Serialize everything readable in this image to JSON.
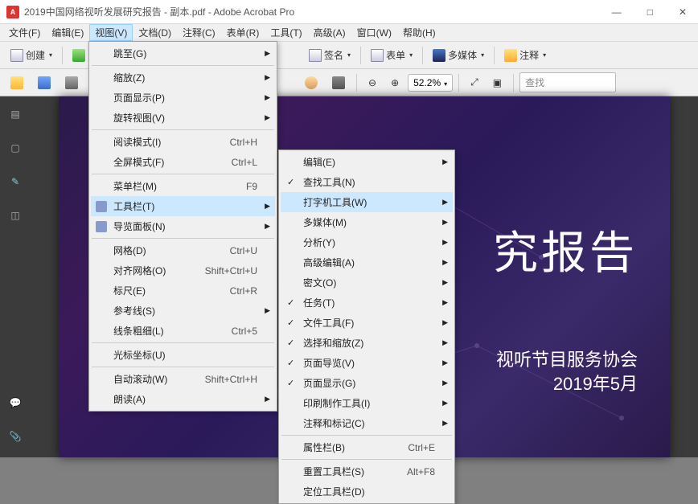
{
  "window": {
    "title": "2019中国网络视听发展研究报告 - 副本.pdf - Adobe Acrobat Pro"
  },
  "winbuttons": {
    "min": "—",
    "max": "□",
    "close": "✕"
  },
  "menubar": [
    {
      "label": "文件(F)",
      "hk": "F"
    },
    {
      "label": "编辑(E)",
      "hk": "E"
    },
    {
      "label": "视图(V)",
      "hk": "V",
      "active": true
    },
    {
      "label": "文档(D)",
      "hk": "D"
    },
    {
      "label": "注释(C)",
      "hk": "C"
    },
    {
      "label": "表单(R)",
      "hk": "R"
    },
    {
      "label": "工具(T)",
      "hk": "T"
    },
    {
      "label": "高级(A)",
      "hk": "A"
    },
    {
      "label": "窗口(W)",
      "hk": "W"
    },
    {
      "label": "帮助(H)",
      "hk": "H"
    }
  ],
  "toolbar1": {
    "create": "创建",
    "sign": "签名",
    "form": "表单",
    "multimedia": "多媒体",
    "annot": "注释"
  },
  "toolbar2": {
    "zoom": "52.2%",
    "search": "查找"
  },
  "viewMenu": {
    "goto": "跳至(G)",
    "zoom": "缩放(Z)",
    "pagedisp": "页面显示(P)",
    "rotate": "旋转视图(V)",
    "readmode": "阅读模式(I)",
    "readmode_sc": "Ctrl+H",
    "fullscreen": "全屏模式(F)",
    "fullscreen_sc": "Ctrl+L",
    "menubar": "菜单栏(M)",
    "menubar_sc": "F9",
    "toolbars": "工具栏(T)",
    "navpanel": "导览面板(N)",
    "grid": "网格(D)",
    "grid_sc": "Ctrl+U",
    "snap": "对齐网格(O)",
    "snap_sc": "Shift+Ctrl+U",
    "ruler": "标尺(E)",
    "ruler_sc": "Ctrl+R",
    "guides": "参考线(S)",
    "linewt": "线条粗细(L)",
    "linewt_sc": "Ctrl+5",
    "cursor": "光标坐标(U)",
    "autoscroll": "自动滚动(W)",
    "autoscroll_sc": "Shift+Ctrl+H",
    "readaloud": "朗读(A)"
  },
  "toolbarsSubmenu": {
    "edit": "编辑(E)",
    "findtools": "查找工具(N)",
    "typewriter": "打字机工具(W)",
    "multimedia": "多媒体(M)",
    "analyze": "分析(Y)",
    "advedit": "高级编辑(A)",
    "security": "密文(O)",
    "tasks": "任务(T)",
    "file": "文件工具(F)",
    "selectzoom": "选择和缩放(Z)",
    "pagenav": "页面导览(V)",
    "pagedisp": "页面显示(G)",
    "printprod": "印刷制作工具(I)",
    "commentmark": "注释和标记(C)",
    "propbar": "属性栏(B)",
    "propbar_sc": "Ctrl+E",
    "resettoolbar": "重置工具栏(S)",
    "resettoolbar_sc": "Alt+F8",
    "docktoolbar": "定位工具栏(D)"
  },
  "document": {
    "heading": "究报告",
    "sub1": "视听节目服务协会",
    "sub2": "2019年5月"
  }
}
